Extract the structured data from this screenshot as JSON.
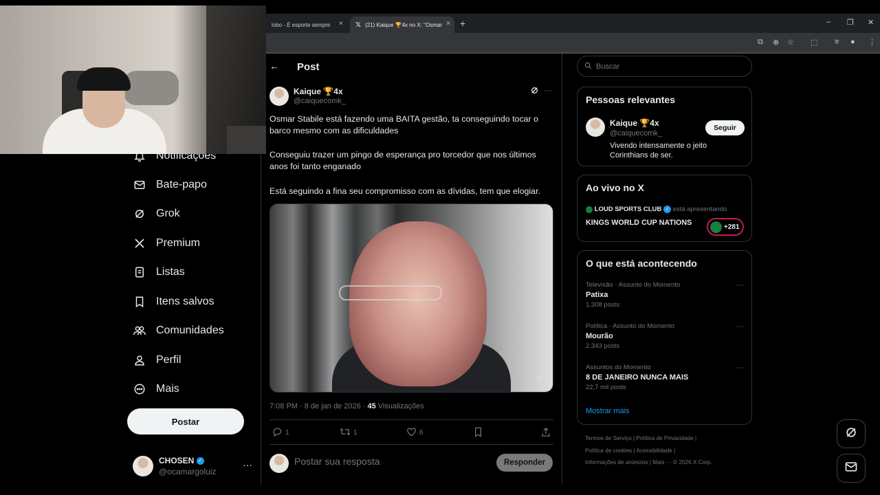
{
  "browser": {
    "tabs": [
      {
        "label": "lobo - É esporte sempre",
        "active": false
      },
      {
        "label": "(21) Kaique 🏆4x no X: \"Osmar",
        "active": true
      }
    ],
    "new_tab": "+",
    "close_glyph": "×",
    "window": {
      "minimize": "–",
      "restore": "❐",
      "close": "✕"
    }
  },
  "nav": {
    "items": [
      {
        "label": "Notificações",
        "icon": "bell-icon"
      },
      {
        "label": "Bate-papo",
        "icon": "mail-icon"
      },
      {
        "label": "Grok",
        "icon": "grok-icon"
      },
      {
        "label": "Premium",
        "icon": "x-logo-icon"
      },
      {
        "label": "Listas",
        "icon": "list-icon"
      },
      {
        "label": "Itens salvos",
        "icon": "bookmark-icon"
      },
      {
        "label": "Comunidades",
        "icon": "communities-icon"
      },
      {
        "label": "Perfil",
        "icon": "person-icon"
      },
      {
        "label": "Mais",
        "icon": "more-circle-icon"
      }
    ],
    "post_button": "Postar",
    "account": {
      "name": "CHOSEN",
      "handle": "@ocamargoluiz",
      "more": "···"
    }
  },
  "post": {
    "header_title": "Post",
    "back": "←",
    "author": {
      "name": "Kaique 🏆4x",
      "handle": "@caiquecomk_"
    },
    "more": "···",
    "paragraphs": [
      "Osmar Stabile está fazendo uma BAITA gestão, ta conseguindo tocar o barco mesmo com as dificuldades",
      "Conseguiu trazer um pingo de esperança pro torcedor que nos últimos anos foi tanto enganado",
      "Está seguindo a fina seu compromisso com as dívidas, tem que elogiar."
    ],
    "meta": {
      "time": "7:08 PM · 8 de jan de 2026 · ",
      "views": "45",
      "views_label": " Visualizações"
    },
    "actions": [
      {
        "name": "reply",
        "glyph": "◯",
        "count": "1"
      },
      {
        "name": "repost",
        "glyph": "⇄",
        "count": "1"
      },
      {
        "name": "like",
        "glyph": "♡",
        "count": "6"
      },
      {
        "name": "bookmark",
        "glyph": "⛉",
        "count": ""
      },
      {
        "name": "share",
        "glyph": "⇪",
        "count": ""
      }
    ],
    "reply_placeholder": "Postar sua resposta",
    "reply_button": "Responder"
  },
  "sidebar": {
    "search_placeholder": "Buscar",
    "relevant": {
      "title": "Pessoas relevantes",
      "name": "Kaique 🏆4x",
      "handle": "@caiquecomk_",
      "bio": "Vivendo intensamente o jeito Corinthians de ser.",
      "follow": "Seguir"
    },
    "live": {
      "title": "Ao vivo no X",
      "host": "LOUD SPORTS CLUB",
      "host_suffix": " está apresentando",
      "event": "KINGS WORLD CUP NATIONS",
      "listeners": "+281"
    },
    "happening": {
      "title": "O que está acontecendo",
      "trends": [
        {
          "category": "Televisão · Assunto do Momento",
          "name": "Patixa",
          "count": "1.308 posts"
        },
        {
          "category": "Política · Assunto do Momento",
          "name": "Mourão",
          "count": "2.343 posts"
        },
        {
          "category": "Assuntos do Momento",
          "name": "8 DE JANEIRO NUNCA MAIS",
          "count": "22,7 mil posts"
        }
      ],
      "show_more": "Mostrar mais"
    },
    "footer": {
      "line1": "Termos de Serviço  |  Política de Privacidade  |",
      "line2": "Política de cookies  |  Acessibilidade  |",
      "line3": "Informações de anúncios  |  Mais ···  © 2026 X Corp."
    }
  }
}
